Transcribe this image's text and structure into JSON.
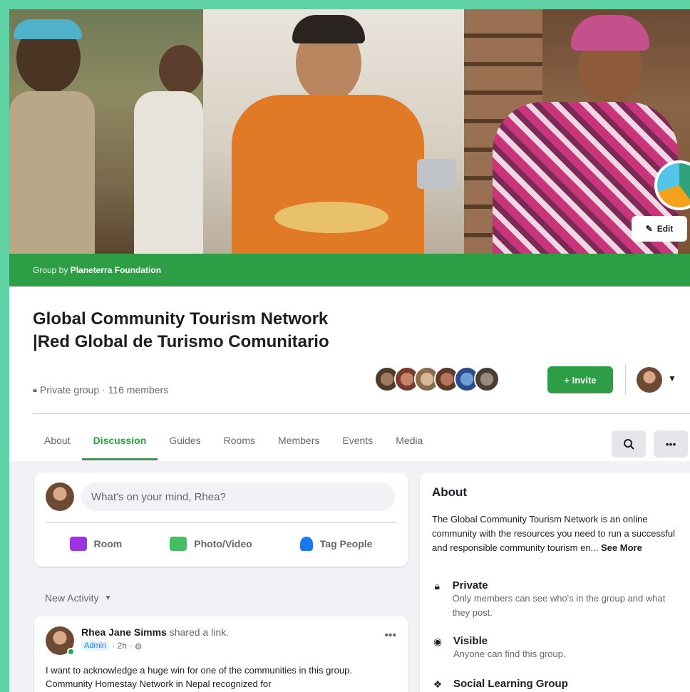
{
  "cover": {
    "edit_label": "Edit",
    "group_by_prefix": "Group by ",
    "group_by_org": "Planeterra Foundation"
  },
  "group": {
    "title": "Global Community Tourism Network |Red Global de Turismo Comunitario",
    "privacy": "Private group · 116 members",
    "invite_label": "+ Invite"
  },
  "tabs": [
    "About",
    "Discussion",
    "Guides",
    "Rooms",
    "Members",
    "Events",
    "Media"
  ],
  "active_tab": "Discussion",
  "composer": {
    "placeholder": "What's on your mind, Rhea?",
    "actions": [
      "Room",
      "Photo/Video",
      "Tag People"
    ]
  },
  "feed": {
    "sort_label": "New Activity"
  },
  "post": {
    "author": "Rhea Jane Simms",
    "action": " shared a link.",
    "badge": "Admin",
    "time": "· 2h ·",
    "text": "I want to acknowledge a huge win for one of the communities in this group. Community Homestay Network in Nepal recognized for"
  },
  "about": {
    "title": "About",
    "description": "The Global Community Tourism Network is an online community with the resources you need to run a successful and responsible community tourism en... ",
    "see_more": "See More",
    "items": [
      {
        "title": "Private",
        "sub": "Only members can see who's in the group and what they post."
      },
      {
        "title": "Visible",
        "sub": "Anyone can find this group."
      },
      {
        "title": "Social Learning Group",
        "sub": ""
      }
    ]
  },
  "colors": {
    "brand_green": "#2e9e46",
    "page_bg": "#5fd3a5"
  }
}
